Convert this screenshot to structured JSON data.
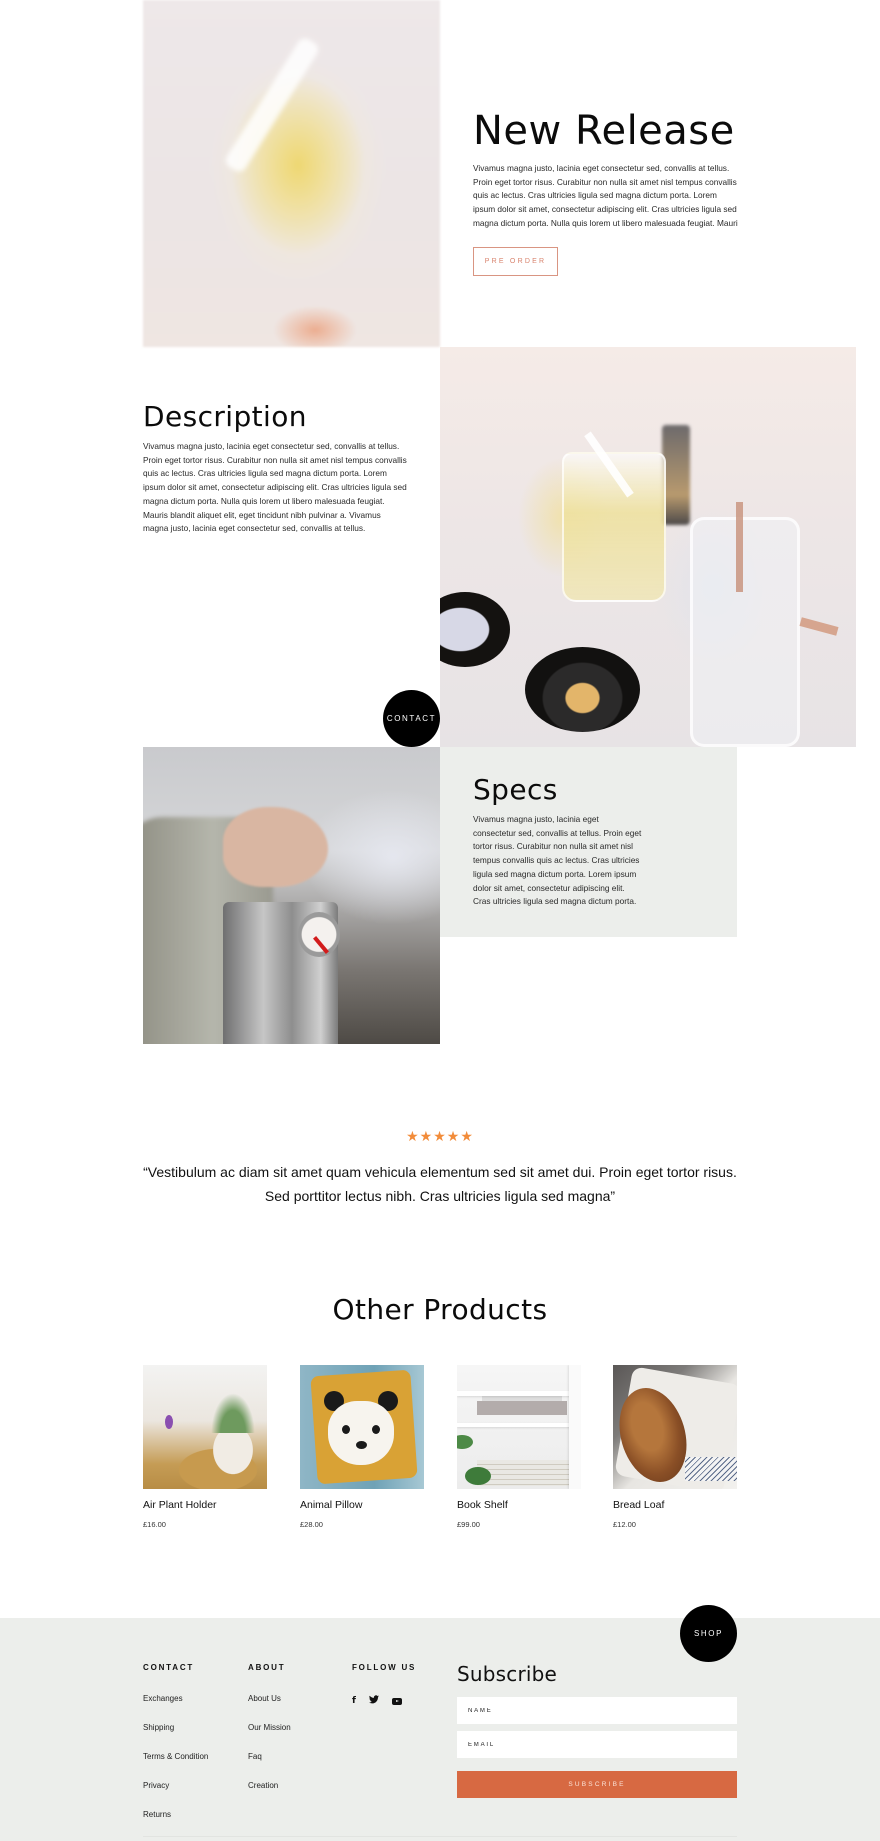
{
  "new_release": {
    "title": "New Release",
    "body": "Vivamus magna justo, lacinia eget consectetur sed, convallis at tellus. Proin eget tortor risus. Curabitur non nulla sit amet nisl tempus convallis quis ac lectus. Cras ultricies ligula sed magna dictum porta. Lorem ipsum dolor sit amet, consectetur adipiscing elit. Cras ultricies ligula sed magna dictum porta. Nulla quis lorem ut libero malesuada feugiat. Mauri",
    "button_label": "PRE ORDER"
  },
  "description": {
    "title": "Description",
    "body": "Vivamus magna justo, lacinia eget consectetur sed, convallis at tellus. Proin eget tortor risus. Curabitur non nulla sit amet nisl tempus convallis quis ac lectus. Cras ultricies ligula sed magna dictum porta. Lorem ipsum dolor sit amet, consectetur adipiscing elit. Cras ultricies ligula sed magna dictum porta. Nulla quis lorem ut libero malesuada feugiat. Mauris blandit aliquet elit, eget tincidunt nibh pulvinar a. Vivamus magna justo, lacinia eget consectetur sed, convallis at tellus."
  },
  "contact_button": {
    "label": "CONTACT"
  },
  "specs": {
    "title": "Specs",
    "body": "Vivamus magna justo, lacinia eget consectetur sed, convallis at tellus. Proin eget tortor risus. Curabitur non nulla sit amet nisl tempus convallis quis ac lectus. Cras ultricies ligula sed magna dictum porta. Lorem ipsum dolor sit amet, consectetur adipiscing elit. Cras ultricies ligula sed magna dictum porta."
  },
  "testimonial": {
    "rating": 5,
    "rating_max": 5,
    "stars": "★★★★★",
    "star_color": "#f28c3a",
    "quote": "“Vestibulum ac diam sit amet quam vehicula elementum sed sit amet dui. Proin eget tortor risus. Sed porttitor lectus nibh. Cras ultricies ligula sed magna”"
  },
  "other_products": {
    "title": "Other Products",
    "items": [
      {
        "name": "Air Plant Holder",
        "price": "£16.00"
      },
      {
        "name": "Animal Pillow",
        "price": "£28.00"
      },
      {
        "name": "Book Shelf",
        "price": "£99.00"
      },
      {
        "name": "Bread Loaf",
        "price": "£12.00"
      }
    ]
  },
  "shop_button": {
    "label": "SHOP"
  },
  "footer": {
    "contact": {
      "heading": "CONTACT",
      "links": [
        "Exchanges",
        "Shipping",
        "Terms & Condition",
        "Privacy",
        "Returns"
      ]
    },
    "about": {
      "heading": "ABOUT",
      "links": [
        "About Us",
        "Our Mission",
        "Faq",
        "Creation"
      ]
    },
    "follow": {
      "heading": "FOLLOW US",
      "icons": [
        "facebook-icon",
        "twitter-icon",
        "youtube-icon"
      ],
      "facebook_glyph": "f",
      "twitter_glyph": "🐦"
    },
    "subscribe": {
      "title": "Subscribe",
      "name_placeholder": "NAME",
      "email_placeholder": "EMAIL",
      "button_label": "SUBSCRIBE",
      "button_color": "#d76942"
    },
    "background_color": "#eceeeb"
  }
}
